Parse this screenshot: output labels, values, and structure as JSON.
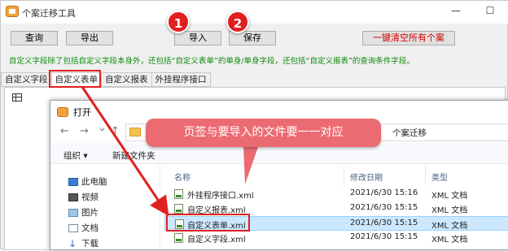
{
  "window": {
    "title": "个案迁移工具",
    "min": "—",
    "max": "☐"
  },
  "toolbar": {
    "query": "查询",
    "export": "导出",
    "import": "导入",
    "save": "保存",
    "clear_all": "一键清空所有个案"
  },
  "hint": "自定义字段除了包括自定义字段本身外，还包括“自定义表单”的单身/单身字段，还包括“自定义报表”的查询条件字段。",
  "tabs": [
    "自定义字段",
    "自定义表单",
    "自定义报表",
    "外挂程序接口"
  ],
  "markers": {
    "one": "1",
    "two": "2"
  },
  "dialog": {
    "title": "打开",
    "nav": {
      "back": "←",
      "forward": "→",
      "down": "⌄",
      "up": "↑"
    },
    "address_tail": "个案迁移",
    "organize": "组织 ▾",
    "new_folder": "新建文件夹",
    "nav_items": [
      "此电脑",
      "视频",
      "图片",
      "文档",
      "下载"
    ],
    "columns": {
      "name": "名称",
      "date": "修改日期",
      "type": "类型"
    },
    "files": [
      {
        "name": "外挂程序接口.xml",
        "date": "2021/6/30 15:16",
        "type": "XML 文档",
        "selected": false
      },
      {
        "name": "自定义报表.xml",
        "date": "2021/6/30 15:15",
        "type": "XML 文档",
        "selected": false
      },
      {
        "name": "自定义表单.xml",
        "date": "2021/6/30 15:15",
        "type": "XML 文档",
        "selected": true
      },
      {
        "name": "自定义字段.xml",
        "date": "2021/6/30 15:15",
        "type": "XML 文档",
        "selected": false
      }
    ]
  },
  "callout": "页签与要导入的文件要一一对应",
  "colors": {
    "hint": "#0a8a0a",
    "callout": "#ec6b73",
    "marker": "#e02020"
  }
}
